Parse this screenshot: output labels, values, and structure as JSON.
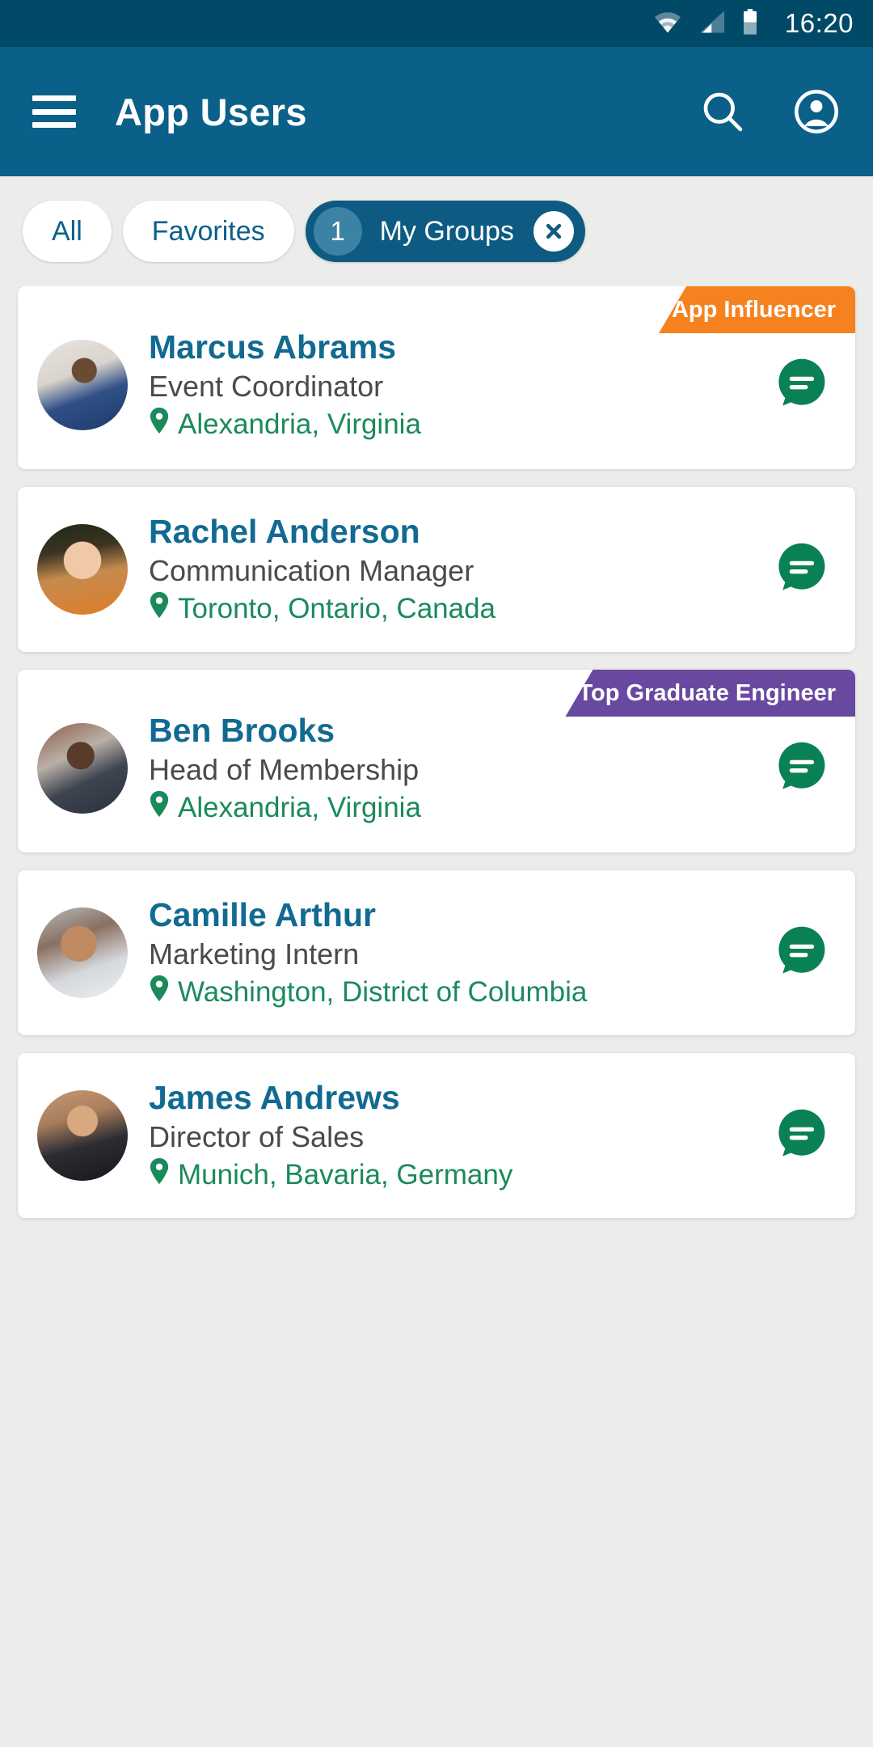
{
  "status_bar": {
    "time": "16:20",
    "icons": [
      "wifi-icon",
      "cellular-signal-icon",
      "battery-icon"
    ]
  },
  "app_bar": {
    "menu_icon": "hamburger-menu-icon",
    "title": "App Users",
    "search_icon": "search-icon",
    "account_icon": "account-circle-icon"
  },
  "filters": {
    "chips": [
      {
        "label": "All",
        "selected": false
      },
      {
        "label": "Favorites",
        "selected": false
      },
      {
        "label": "My Groups",
        "selected": true,
        "count": "1",
        "close_icon": "close-x-icon"
      }
    ]
  },
  "colors": {
    "status_bar_bg": "#004a68",
    "app_bar_bg": "#0a6089",
    "page_bg": "#ececeb",
    "chip_selected_bg": "#0d5b82",
    "chip_count_bg": "#3c82a5",
    "chip_text": "#0a6089",
    "name_text": "#116a92",
    "role_text": "#4a4a4a",
    "location_text": "#1a8a5c",
    "chat_button": "#0a8055",
    "badge_orange": "#f5821f",
    "badge_purple": "#68499f",
    "card_bg": "#ffffff"
  },
  "users": [
    {
      "name": "Marcus Abrams",
      "role": "Event Coordinator",
      "location": "Alexandria, Virginia",
      "badge": {
        "label": "App Influencer",
        "color": "orange"
      },
      "chat_icon": "chat-bubble-icon",
      "pin_icon": "location-pin-icon",
      "avatar": "avatar-marcus-abrams"
    },
    {
      "name": "Rachel Anderson",
      "role": "Communication Manager",
      "location": "Toronto, Ontario, Canada",
      "badge": null,
      "chat_icon": "chat-bubble-icon",
      "pin_icon": "location-pin-icon",
      "avatar": "avatar-rachel-anderson"
    },
    {
      "name": "Ben Brooks",
      "role": "Head of Membership",
      "location": "Alexandria, Virginia",
      "badge": {
        "label": "Top Graduate Engineer",
        "color": "purple"
      },
      "chat_icon": "chat-bubble-icon",
      "pin_icon": "location-pin-icon",
      "avatar": "avatar-ben-brooks"
    },
    {
      "name": "Camille Arthur",
      "role": "Marketing Intern",
      "location": "Washington, District of Columbia",
      "badge": null,
      "chat_icon": "chat-bubble-icon",
      "pin_icon": "location-pin-icon",
      "avatar": "avatar-camille-arthur"
    },
    {
      "name": "James Andrews",
      "role": "Director of Sales",
      "location": "Munich, Bavaria, Germany",
      "badge": null,
      "chat_icon": "chat-bubble-icon",
      "pin_icon": "location-pin-icon",
      "avatar": "avatar-james-andrews"
    }
  ]
}
